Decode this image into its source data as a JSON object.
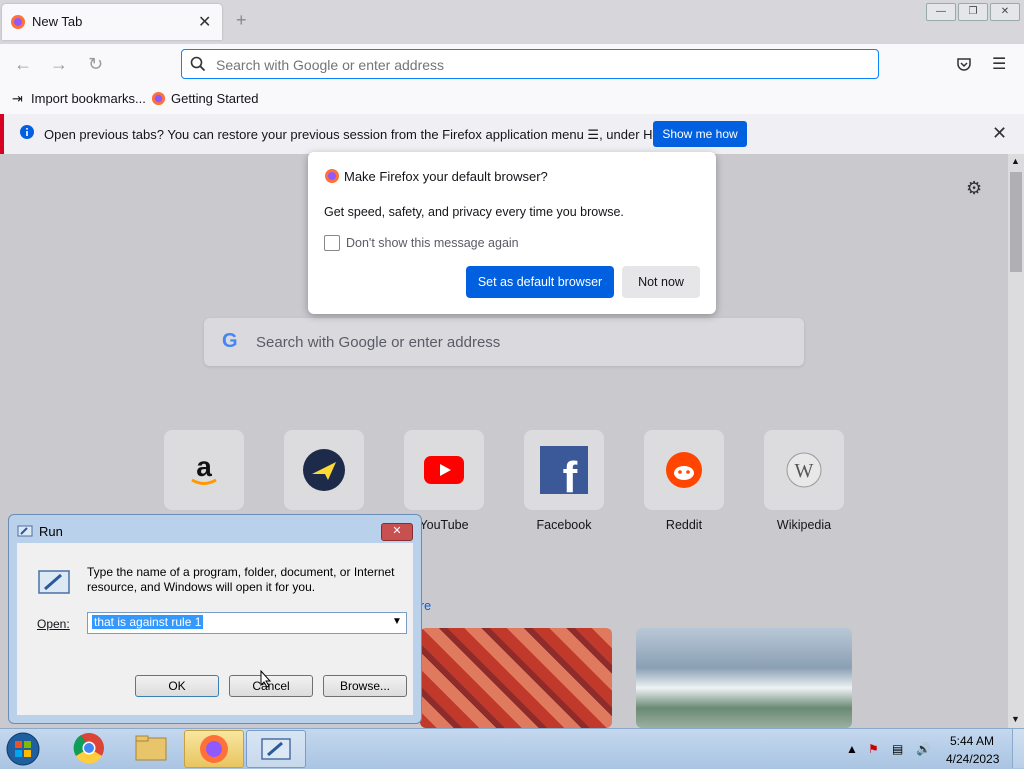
{
  "browser": {
    "tab": {
      "title": "New Tab",
      "close": "✕"
    },
    "newtab_symbol": "+",
    "urlbar": {
      "placeholder": "Search with Google or enter address"
    },
    "bookmarks": [
      {
        "label": "Import bookmarks..."
      },
      {
        "label": "Getting Started"
      }
    ],
    "notification": {
      "text": "Open previous tabs? You can restore your previous session from the Firefox application menu ☰, under History.",
      "button": "Show me how",
      "close": "✕"
    }
  },
  "modal": {
    "title": "Make Firefox your default browser?",
    "body": "Get speed, safety, and privacy every time you browse.",
    "checkbox_label": "Don't show this message again",
    "primary_button": "Set as default browser",
    "secondary_button": "Not now"
  },
  "newtab_page": {
    "search_placeholder": "Search with Google or enter address",
    "search_logo": "G",
    "shortcuts": [
      {
        "label": "",
        "icon": "amazon-icon"
      },
      {
        "label": "",
        "icon": "expedia-icon"
      },
      {
        "label": "YouTube",
        "icon": "youtube-icon"
      },
      {
        "label": "Facebook",
        "icon": "facebook-icon"
      },
      {
        "label": "Reddit",
        "icon": "reddit-icon"
      },
      {
        "label": "Wikipedia",
        "icon": "wikipedia-icon"
      }
    ],
    "partial_link": "re"
  },
  "run_dialog": {
    "title": "Run",
    "close": "✕",
    "description": "Type the name of a program, folder, document, or Internet resource, and Windows will open it for you.",
    "open_label": "Open:",
    "open_value": "that is against rule 1",
    "ok": "OK",
    "cancel": "Cancel",
    "browse": "Browse..."
  },
  "taskbar": {
    "time": "5:44 AM",
    "date": "4/24/2023"
  },
  "colors": {
    "accent": "#0060df",
    "notif_stripe": "#d70022"
  }
}
